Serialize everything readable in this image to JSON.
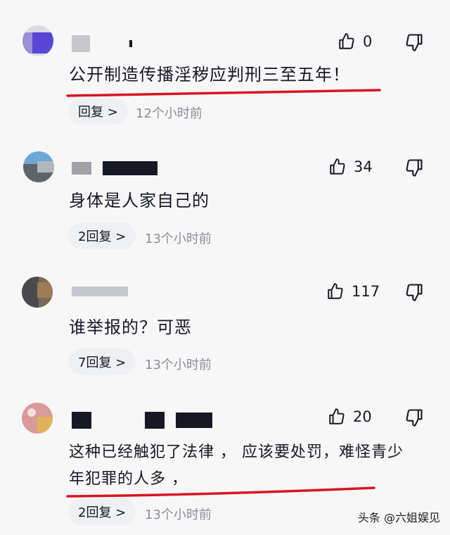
{
  "comments": [
    {
      "text": "公开制造传播淫秽应判刑三至五年！",
      "likes": "0",
      "reply": "回复 >",
      "time": "12个小时前"
    },
    {
      "text": "身体是人家自己的",
      "likes": "34",
      "reply": "2回复 >",
      "time": "13个小时前"
    },
    {
      "text": "谁举报的？可恶",
      "likes": "117",
      "reply": "7回复 >",
      "time": "13个小时前"
    },
    {
      "text_line1": "这种已经触犯了法律 ， 应该要处罚，难怪青少",
      "text_line2": "年犯罪的人多 ，",
      "likes": "20",
      "reply": "2回复 >",
      "time": "13个小时前"
    }
  ],
  "watermark": "头条 @六姐娱见",
  "icons": {
    "like": "thumbs-up-icon",
    "dislike": "thumbs-down-icon"
  },
  "colors": {
    "underline": "#d9141f",
    "background": "#f7f7f8"
  }
}
